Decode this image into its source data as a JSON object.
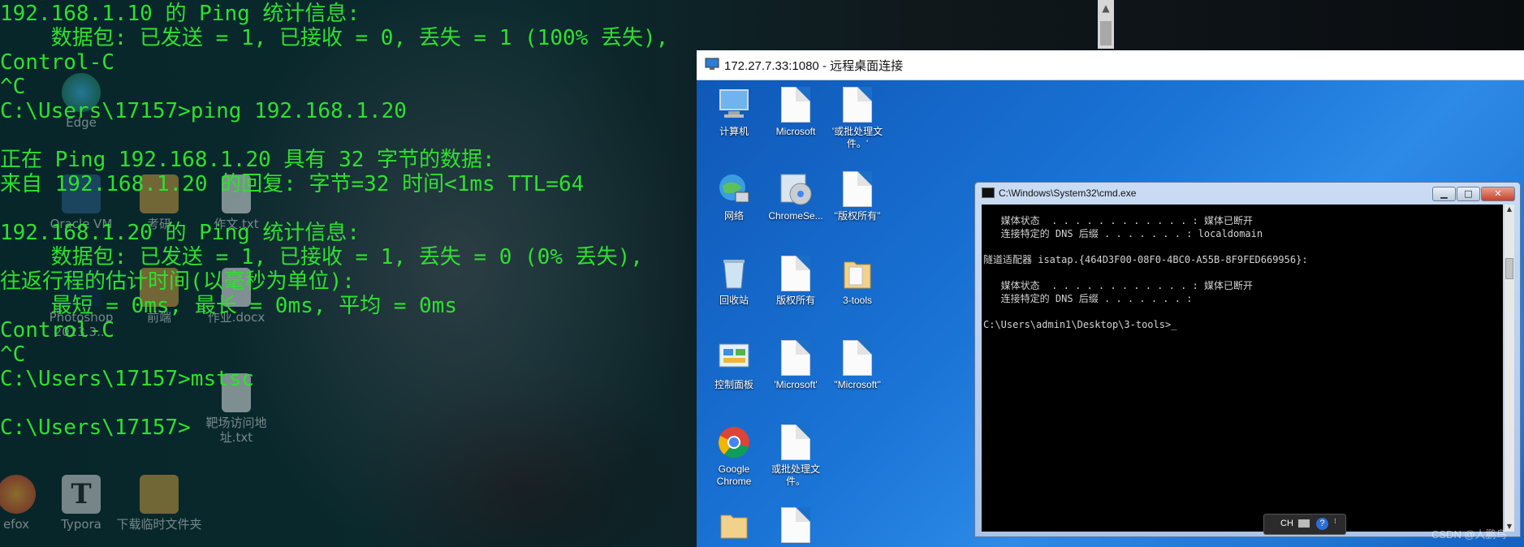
{
  "host": {
    "desktop_icons": [
      {
        "label": "Edge",
        "icon": "edge-icon"
      },
      {
        "label": "Oracle VM",
        "icon": "virtualbox-icon"
      },
      {
        "label": "考研",
        "icon": "folder-icon"
      },
      {
        "label": "作文.txt",
        "icon": "text-file-icon"
      },
      {
        "label": "Photoshop 2023.3...",
        "icon": "photoshop-icon"
      },
      {
        "label": "前端",
        "icon": "folder-icon"
      },
      {
        "label": "作业.docx",
        "icon": "docx-file-icon"
      },
      {
        "label": "靶场访问地址.txt",
        "icon": "text-file-icon"
      },
      {
        "label": "efox",
        "icon": "firefox-icon"
      },
      {
        "label": "Typora",
        "icon": "typora-icon"
      },
      {
        "label": "下载临时文件夹",
        "icon": "folder-icon"
      }
    ],
    "console_lines": [
      "192.168.1.10 的 Ping 统计信息:",
      "    数据包: 已发送 = 1, 已接收 = 0, 丢失 = 1 (100% 丢失),",
      "Control-C",
      "^C",
      "C:\\Users\\17157>ping 192.168.1.20",
      "",
      "正在 Ping 192.168.1.20 具有 32 字节的数据:",
      "来自 192.168.1.20 的回复: 字节=32 时间<1ms TTL=64",
      "",
      "192.168.1.20 的 Ping 统计信息:",
      "    数据包: 已发送 = 1, 已接收 = 1, 丢失 = 0 (0% 丢失),",
      "往返行程的估计时间(以毫秒为单位):",
      "    最短 = 0ms, 最长 = 0ms, 平均 = 0ms",
      "Control-C",
      "^C",
      "C:\\Users\\17157>mstsc",
      "",
      "C:\\Users\\17157>"
    ]
  },
  "rdp": {
    "title": "172.27.7.33:1080 - 远程桌面连接",
    "desktop_icons": [
      {
        "label": "计算机",
        "icon": "computer-icon"
      },
      {
        "label": "Microsoft",
        "icon": "document-icon"
      },
      {
        "label": "'或批处理文件。'",
        "icon": "document-icon"
      },
      {
        "label": "网络",
        "icon": "network-icon"
      },
      {
        "label": "ChromeSe...",
        "icon": "chrome-setup-icon"
      },
      {
        "label": "''版权所有''",
        "icon": "document-icon"
      },
      {
        "label": "回收站",
        "icon": "recycle-bin-icon"
      },
      {
        "label": "版权所有",
        "icon": "document-icon"
      },
      {
        "label": "3-tools",
        "icon": "folder-icon"
      },
      {
        "label": "控制面板",
        "icon": "control-panel-icon"
      },
      {
        "label": "'Microsoft'",
        "icon": "document-icon"
      },
      {
        "label": "''Microsoft''",
        "icon": "document-icon"
      },
      {
        "label": "Google Chrome",
        "icon": "chrome-icon"
      },
      {
        "label": "或批处理文件。",
        "icon": "document-icon"
      },
      {
        "label": "",
        "icon": "folder-icon"
      },
      {
        "label": "",
        "icon": "document-icon"
      }
    ],
    "cmd": {
      "title": "C:\\Windows\\System32\\cmd.exe",
      "lines": [
        "   媒体状态  . . . . . . . . . . . . : 媒体已断开",
        "   连接特定的 DNS 后缀 . . . . . . . : localdomain",
        "",
        "隧道适配器 isatap.{464D3F00-08F0-4BC0-A55B-8F9FED669956}:",
        "",
        "   媒体状态  . . . . . . . . . . . . : 媒体已断开",
        "   连接特定的 DNS 后缀 . . . . . . . :",
        "",
        "C:\\Users\\admin1\\Desktop\\3-tools>_"
      ],
      "buttons": {
        "minimize": "▁",
        "maximize": "□",
        "close": "✕"
      }
    },
    "language_bar": {
      "lang": "CH",
      "help": "?"
    }
  },
  "watermark": "CSDN @人鹏鸟",
  "colors": {
    "console_text": "#2fe02f",
    "rdp_desktop": "#1a6fc7",
    "cmd_bg": "#000000"
  }
}
